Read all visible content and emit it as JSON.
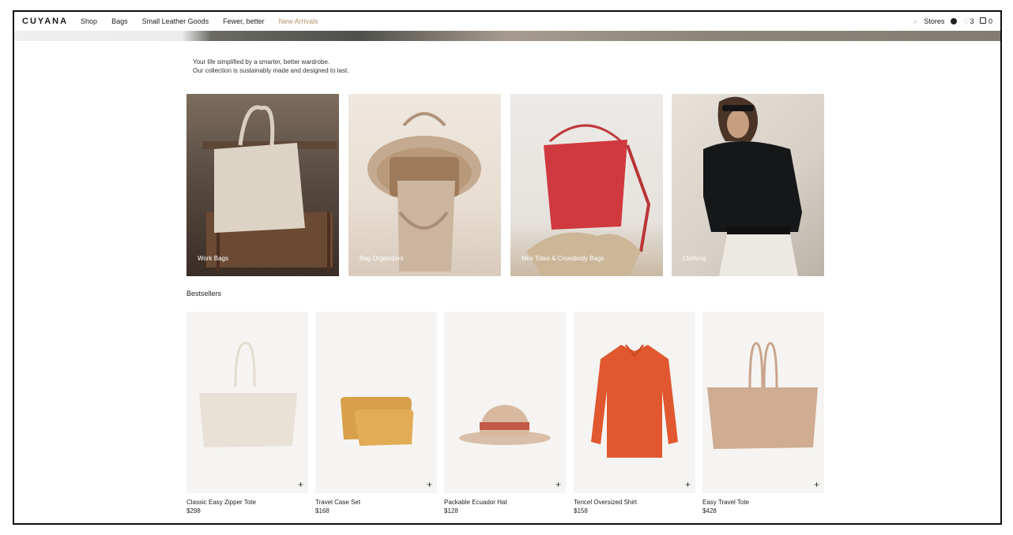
{
  "nav": {
    "logo": "CUYANA",
    "links": [
      "Shop",
      "Bags",
      "Small Leather Goods",
      "Fewer, better",
      "New Arrivals"
    ],
    "stores": "Stores",
    "wishlist_count": "3",
    "cart_count": "0"
  },
  "intro": {
    "line1": "Your life simplified by a smarter, better wardrobe.",
    "line2": "Our collection is sustainably made and designed to last."
  },
  "categories": [
    {
      "label": "Work Bags"
    },
    {
      "label": "Bag Organizers"
    },
    {
      "label": "Mini Totes & Crossbody Bags"
    },
    {
      "label": "Clothing"
    }
  ],
  "bestsellers_title": "Bestsellers",
  "products": [
    {
      "name": "Classic Easy Zipper Tote",
      "price": "$298"
    },
    {
      "name": "Travel Case Set",
      "price": "$168"
    },
    {
      "name": "Packable Ecuador Hat",
      "price": "$128"
    },
    {
      "name": "Tencel Oversized Shirt",
      "price": "$158"
    },
    {
      "name": "Easy Travel Tote",
      "price": "$428"
    }
  ],
  "colors": {
    "accent": "#b9936b"
  }
}
